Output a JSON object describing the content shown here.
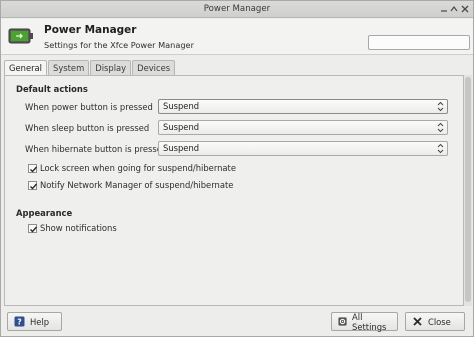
{
  "window": {
    "title": "Power Manager"
  },
  "header": {
    "title": "Power Manager",
    "subtitle": "Settings for the Xfce Power Manager",
    "search_placeholder": "",
    "icon": "battery-icon"
  },
  "tabs": [
    {
      "label": "General",
      "active": true
    },
    {
      "label": "System",
      "active": false
    },
    {
      "label": "Display",
      "active": false
    },
    {
      "label": "Devices",
      "active": false
    }
  ],
  "general": {
    "default_actions_title": "Default actions",
    "rows": [
      {
        "label": "When power button is pressed",
        "value": "Suspend"
      },
      {
        "label": "When sleep button is pressed",
        "value": "Suspend"
      },
      {
        "label": "When hibernate button is pressed",
        "value": "Suspend"
      }
    ],
    "checks": [
      {
        "label": "Lock screen when going for suspend/hibernate",
        "checked": true
      },
      {
        "label": "Notify Network Manager of suspend/hibernate",
        "checked": true
      }
    ],
    "appearance_title": "Appearance",
    "appearance_checks": [
      {
        "label": "Show notifications",
        "checked": true
      }
    ]
  },
  "buttons": {
    "help": "Help",
    "all_settings": "All Settings",
    "close": "Close"
  },
  "colors": {
    "battery_green": "#4aa32f",
    "window_bg": "#ededec"
  }
}
